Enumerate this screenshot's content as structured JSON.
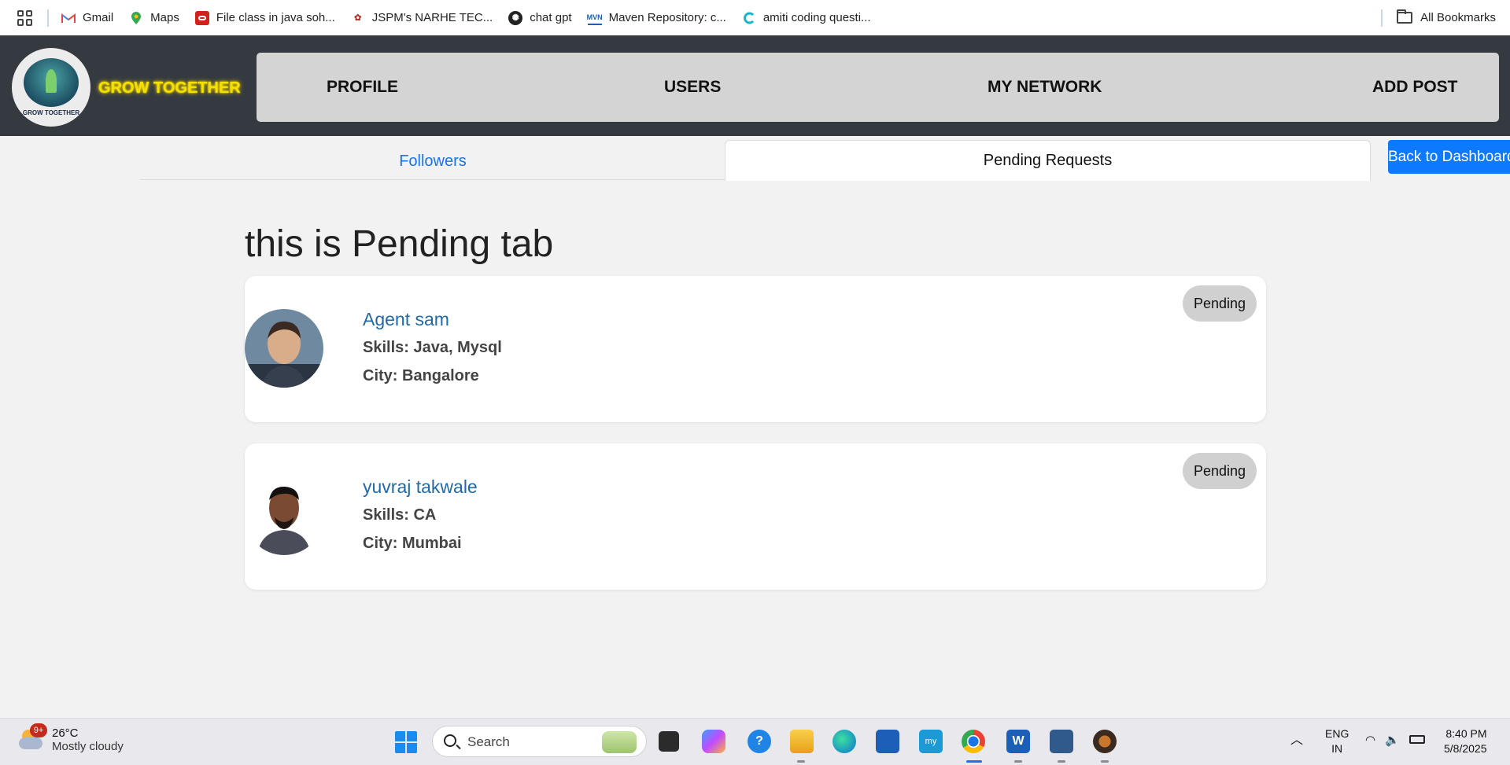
{
  "bookmarks": {
    "items": [
      {
        "label": "Gmail",
        "icon": "gmail-icon"
      },
      {
        "label": "Maps",
        "icon": "maps-icon"
      },
      {
        "label": "File class in java soh...",
        "icon": "oracle-icon"
      },
      {
        "label": "JSPM's NARHE TEC...",
        "icon": "jspm-icon"
      },
      {
        "label": "chat gpt",
        "icon": "chatgpt-icon"
      },
      {
        "label": "Maven Repository: c...",
        "icon": "maven-icon"
      },
      {
        "label": "amiti coding questi...",
        "icon": "coding-icon"
      }
    ],
    "all_bookmarks": "All Bookmarks"
  },
  "header": {
    "logo_text": "GROW TOGETHER",
    "brand": "GROW TOGETHER",
    "nav": [
      "PROFILE",
      "USERS",
      "MY NETWORK",
      "ADD POST"
    ]
  },
  "tabs": {
    "followers": "Followers",
    "pending": "Pending Requests",
    "back_button": "Back to Dashboard"
  },
  "main": {
    "title": "this is Pending tab",
    "requests": [
      {
        "name": "Agent sam",
        "skills": "Skills: Java, Mysql",
        "city": "City: Bangalore",
        "status": "Pending"
      },
      {
        "name": "yuvraj takwale",
        "skills": "Skills: CA",
        "city": "City: Mumbai",
        "status": "Pending"
      }
    ]
  },
  "taskbar": {
    "weather_badge": "9+",
    "temperature": "26°C",
    "weather_desc": "Mostly cloudy",
    "search_placeholder": "Search",
    "language": "ENG",
    "region": "IN",
    "time": "8:40 PM",
    "date": "5/8/2025"
  },
  "colors": {
    "header_bg": "#353a40",
    "brand": "#f5e000",
    "nav_bg": "#d4d4d4",
    "accent_blue": "#0d79ff",
    "link": "#1f6aa8"
  }
}
